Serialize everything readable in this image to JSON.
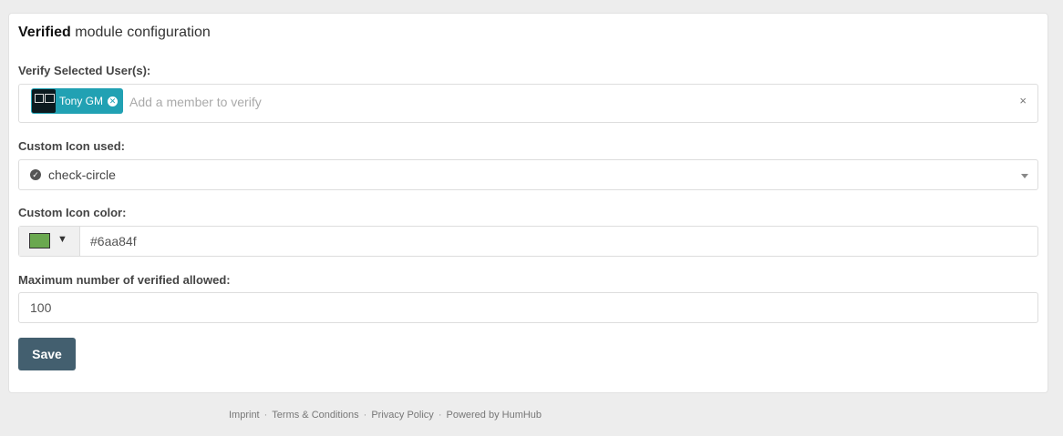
{
  "panel": {
    "title_bold": "Verified",
    "title_rest": "module configuration"
  },
  "fields": {
    "users": {
      "label": "Verify Selected User(s):",
      "selected_tag": "Tony GM",
      "placeholder": "Add a member to verify",
      "clear_icon": "×"
    },
    "icon": {
      "label": "Custom Icon used:",
      "value": "check-circle",
      "icon_name": "check-circle-icon"
    },
    "color": {
      "label": "Custom Icon color:",
      "value": "#6aa84f",
      "swatch_color": "#6aa84f"
    },
    "max_verified": {
      "label": "Maximum number of verified allowed:",
      "value": "100"
    }
  },
  "actions": {
    "save_label": "Save"
  },
  "footer": {
    "links": [
      "Imprint",
      "Terms & Conditions",
      "Privacy Policy"
    ],
    "powered_prefix": "Powered by",
    "powered_brand": "HumHub"
  },
  "colors": {
    "accent": "#21a1b3",
    "save_button": "#435f6f"
  }
}
